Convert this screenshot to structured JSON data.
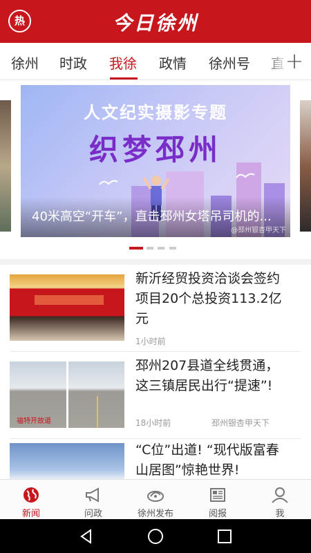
{
  "header": {
    "hot_label": "热",
    "title": "今日徐州"
  },
  "tabs": [
    {
      "label": "徐州",
      "active": false
    },
    {
      "label": "时政",
      "active": false
    },
    {
      "label": "我徐",
      "active": true
    },
    {
      "label": "政情",
      "active": false
    },
    {
      "label": "徐州号",
      "active": false
    },
    {
      "label": "直",
      "active": false
    }
  ],
  "add_tab_label": "+",
  "carousel": {
    "subtitle": "人文纪实摄影专题",
    "headline": "织梦邳州",
    "caption": "40米高空“开车”，直击邳州女塔吊司机的...",
    "source": "@邳州银杏甲天下",
    "slide_count": 4,
    "active_index": 0
  },
  "news": [
    {
      "title": "新沂经贸投资洽谈会签约项目20个总投资113.2亿元",
      "time": "1小时前",
      "source": ""
    },
    {
      "title": "邳州207县道全线贯通，这三镇居民出行“提速”!",
      "time": "18小时前",
      "source": "邳州银杏甲天下",
      "thumb_stamp": "福特开故道"
    },
    {
      "title": "“C位”出道! “现代版富春山居图”惊艳世界!",
      "time": "",
      "source": ""
    }
  ],
  "bottom_nav": [
    {
      "label": "新闻",
      "icon": "globe-icon",
      "active": true
    },
    {
      "label": "问政",
      "icon": "megaphone-icon",
      "active": false
    },
    {
      "label": "徐州发布",
      "icon": "publish-logo-icon",
      "active": false
    },
    {
      "label": "阅报",
      "icon": "newspaper-icon",
      "active": false
    },
    {
      "label": "我",
      "icon": "user-icon",
      "active": false
    }
  ],
  "colors": {
    "brand_red": "#c8161d",
    "inactive_text": "#555555",
    "meta_text": "#999999"
  }
}
